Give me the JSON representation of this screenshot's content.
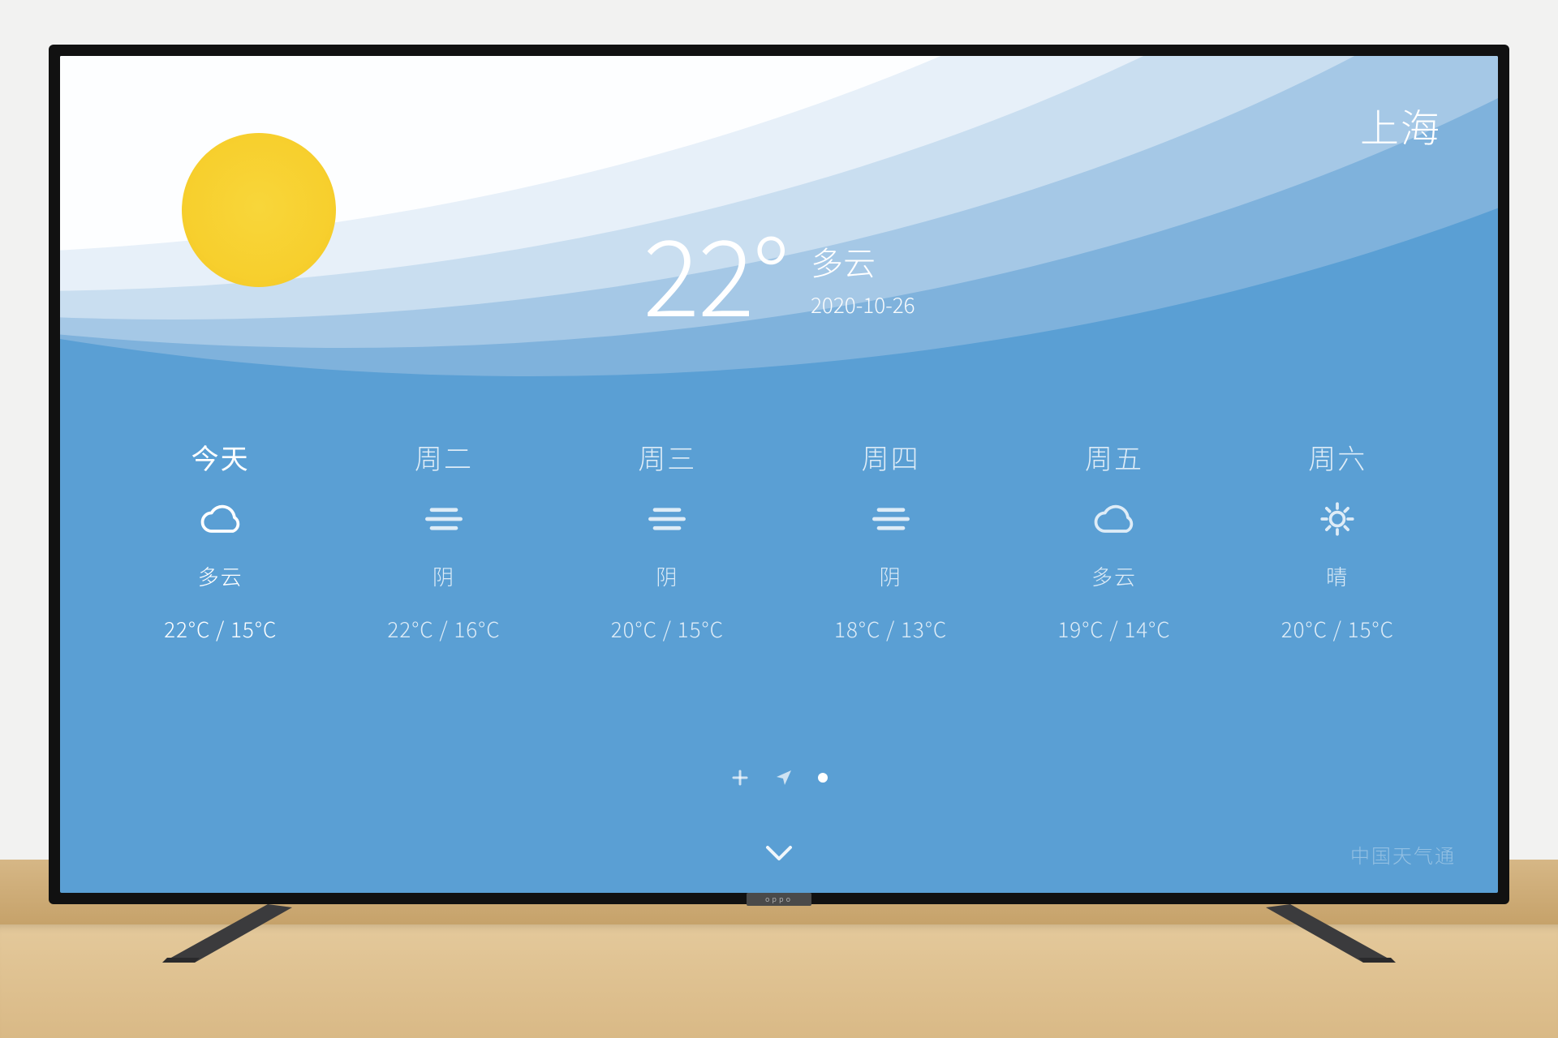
{
  "brand": "oppo",
  "city": "上海",
  "current": {
    "temp": "22°",
    "condition": "多云",
    "date": "2020-10-26"
  },
  "forecast": [
    {
      "label": "今天",
      "icon": "cloud",
      "condition": "多云",
      "high": "22°C",
      "low": "15°C",
      "today": true
    },
    {
      "label": "周二",
      "icon": "overcast",
      "condition": "阴",
      "high": "22°C",
      "low": "16°C",
      "today": false
    },
    {
      "label": "周三",
      "icon": "overcast",
      "condition": "阴",
      "high": "20°C",
      "low": "15°C",
      "today": false
    },
    {
      "label": "周四",
      "icon": "overcast",
      "condition": "阴",
      "high": "18°C",
      "low": "13°C",
      "today": false
    },
    {
      "label": "周五",
      "icon": "cloud",
      "condition": "多云",
      "high": "19°C",
      "low": "14°C",
      "today": false
    },
    {
      "label": "周六",
      "icon": "sun",
      "condition": "晴",
      "high": "20°C",
      "low": "15°C",
      "today": false
    }
  ],
  "provider": "中国天气通"
}
